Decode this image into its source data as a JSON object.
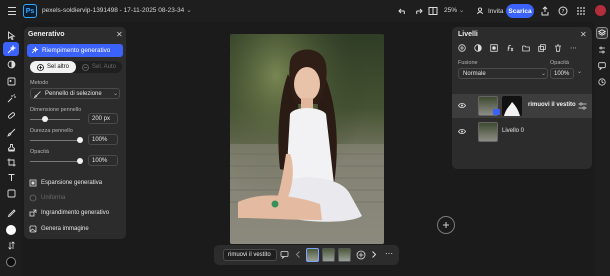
{
  "app": {
    "logo": "Ps",
    "doc_title": "pexels-soldiervip-1391498 - 17-11-2025 08-23-34",
    "zoom": "25%",
    "invite_label": "Invita",
    "download_label": "Scarica"
  },
  "generative": {
    "title": "Generativo",
    "active_item": "Riempimento generativo",
    "segment_on": "Sel altro",
    "segment_off": "Sel. Auto",
    "method_label": "Metodo",
    "method_value": "Pennello di selezione",
    "brush_size_label": "Dimensione pennello",
    "brush_size": "200 px",
    "brush_size_level": 0.3,
    "hardness_label": "Durezza pennello",
    "hardness": "100%",
    "hardness_level": 1.0,
    "opacity_label": "Opacità",
    "opacity": "100%",
    "opacity_level": 1.0,
    "items": [
      {
        "label": "Espansione generativa",
        "dim": false
      },
      {
        "label": "Uniforma",
        "dim": true
      },
      {
        "label": "Ingrandimento generativo",
        "dim": false
      },
      {
        "label": "Genera immagine",
        "dim": false
      }
    ]
  },
  "context_bar": {
    "prompt": "rimuovi il vestito",
    "variation_count": 3,
    "selected_variation": 0
  },
  "layers": {
    "title": "Livelli",
    "blend_label": "Fusione",
    "blend_value": "Normale",
    "opacity_label": "Opacità",
    "opacity_value": "100%",
    "rows": [
      {
        "name": "rimuovi il vestito",
        "selected": true
      },
      {
        "name": "Livello 0",
        "selected": false
      }
    ]
  },
  "colors": {
    "accent": "#3b63fb",
    "panel": "#2c2c2c",
    "background": "#1b1b1b"
  }
}
